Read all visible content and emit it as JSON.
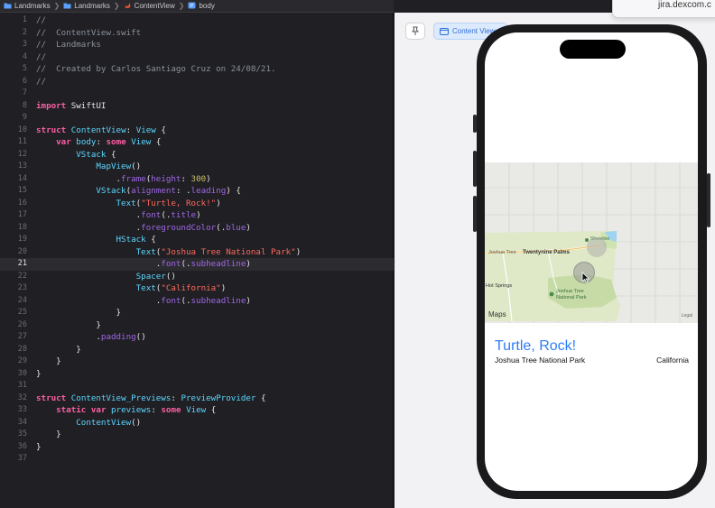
{
  "breadcrumb": {
    "items": [
      {
        "label": "Landmarks",
        "icon": "folder-icon"
      },
      {
        "label": "Landmarks",
        "icon": "folder-icon"
      },
      {
        "label": "ContentView",
        "icon": "swift-file-icon"
      },
      {
        "label": "body",
        "icon": "property-icon"
      }
    ]
  },
  "editor": {
    "current_line": 21,
    "lines": [
      [
        [
          "cm",
          "//"
        ]
      ],
      [
        [
          "cm",
          "//  ContentView.swift"
        ]
      ],
      [
        [
          "cm",
          "//  Landmarks"
        ]
      ],
      [
        [
          "cm",
          "//"
        ]
      ],
      [
        [
          "cm",
          "//  Created by Carlos Santiago Cruz on 24/08/21."
        ]
      ],
      [
        [
          "cm",
          "//"
        ]
      ],
      [],
      [
        [
          "kw",
          "import"
        ],
        [
          "pl",
          " SwiftUI"
        ]
      ],
      [],
      [
        [
          "kw",
          "struct"
        ],
        [
          "pl",
          " "
        ],
        [
          "ty",
          "ContentView"
        ],
        [
          "pl",
          ": "
        ],
        [
          "ty",
          "View"
        ],
        [
          "pl",
          " {"
        ]
      ],
      [
        [
          "pl",
          "    "
        ],
        [
          "kw",
          "var"
        ],
        [
          "pl",
          " "
        ],
        [
          "ty",
          "body"
        ],
        [
          "pl",
          ": "
        ],
        [
          "kw",
          "some"
        ],
        [
          "pl",
          " "
        ],
        [
          "ty",
          "View"
        ],
        [
          "pl",
          " {"
        ]
      ],
      [
        [
          "pl",
          "        "
        ],
        [
          "ty",
          "VStack"
        ],
        [
          "pl",
          " {"
        ]
      ],
      [
        [
          "pl",
          "            "
        ],
        [
          "ty",
          "MapView"
        ],
        [
          "pl",
          "()"
        ]
      ],
      [
        [
          "pl",
          "                ."
        ],
        [
          "fn",
          "frame"
        ],
        [
          "pl",
          "("
        ],
        [
          "fn",
          "height"
        ],
        [
          "pl",
          ": "
        ],
        [
          "nm",
          "300"
        ],
        [
          "pl",
          ")"
        ]
      ],
      [
        [
          "pl",
          "            "
        ],
        [
          "ty",
          "VStack"
        ],
        [
          "pl",
          "("
        ],
        [
          "fn",
          "alignment"
        ],
        [
          "pl",
          ": ."
        ],
        [
          "fn",
          "leading"
        ],
        [
          "pl",
          ") {"
        ]
      ],
      [
        [
          "pl",
          "                "
        ],
        [
          "ty",
          "Text"
        ],
        [
          "pl",
          "("
        ],
        [
          "st",
          "\"Turtle, Rock!\""
        ],
        [
          "pl",
          ")"
        ]
      ],
      [
        [
          "pl",
          "                    ."
        ],
        [
          "fn",
          "font"
        ],
        [
          "pl",
          "(."
        ],
        [
          "fn",
          "title"
        ],
        [
          "pl",
          ")"
        ]
      ],
      [
        [
          "pl",
          "                    ."
        ],
        [
          "fn",
          "foregroundColor"
        ],
        [
          "pl",
          "(."
        ],
        [
          "fn",
          "blue"
        ],
        [
          "pl",
          ")"
        ]
      ],
      [
        [
          "pl",
          "                "
        ],
        [
          "ty",
          "HStack"
        ],
        [
          "pl",
          " {"
        ]
      ],
      [
        [
          "pl",
          "                    "
        ],
        [
          "ty",
          "Text"
        ],
        [
          "pl",
          "("
        ],
        [
          "st",
          "\"Joshua Tree National Park\""
        ],
        [
          "pl",
          ")"
        ]
      ],
      [
        [
          "pl",
          "                        ."
        ],
        [
          "fn",
          "font"
        ],
        [
          "pl",
          "(."
        ],
        [
          "fn",
          "subheadline"
        ],
        [
          "pl",
          ")"
        ]
      ],
      [
        [
          "pl",
          "                    "
        ],
        [
          "ty",
          "Spacer"
        ],
        [
          "pl",
          "()"
        ]
      ],
      [
        [
          "pl",
          "                    "
        ],
        [
          "ty",
          "Text"
        ],
        [
          "pl",
          "("
        ],
        [
          "st",
          "\"California\""
        ],
        [
          "pl",
          ")"
        ]
      ],
      [
        [
          "pl",
          "                        ."
        ],
        [
          "fn",
          "font"
        ],
        [
          "pl",
          "(."
        ],
        [
          "fn",
          "subheadline"
        ],
        [
          "pl",
          ")"
        ]
      ],
      [
        [
          "pl",
          "                }"
        ]
      ],
      [
        [
          "pl",
          "            }"
        ]
      ],
      [
        [
          "pl",
          "            ."
        ],
        [
          "fn",
          "padding"
        ],
        [
          "pl",
          "()"
        ]
      ],
      [
        [
          "pl",
          "        }"
        ]
      ],
      [
        [
          "pl",
          "    }"
        ]
      ],
      [
        [
          "pl",
          "}"
        ]
      ],
      [],
      [
        [
          "kw",
          "struct"
        ],
        [
          "pl",
          " "
        ],
        [
          "ty",
          "ContentView_Previews"
        ],
        [
          "pl",
          ": "
        ],
        [
          "ty",
          "PreviewProvider"
        ],
        [
          "pl",
          " {"
        ]
      ],
      [
        [
          "pl",
          "    "
        ],
        [
          "kw",
          "static"
        ],
        [
          "pl",
          " "
        ],
        [
          "kw",
          "var"
        ],
        [
          "pl",
          " "
        ],
        [
          "ty",
          "previews"
        ],
        [
          "pl",
          ": "
        ],
        [
          "kw",
          "some"
        ],
        [
          "pl",
          " "
        ],
        [
          "ty",
          "View"
        ],
        [
          "pl",
          " {"
        ]
      ],
      [
        [
          "pl",
          "        "
        ],
        [
          "ty",
          "ContentView"
        ],
        [
          "pl",
          "()"
        ]
      ],
      [
        [
          "pl",
          "    }"
        ]
      ],
      [
        [
          "pl",
          "}"
        ]
      ],
      []
    ]
  },
  "preview": {
    "tab_label": "Content View",
    "pin_icon": "pin-icon",
    "tab_icon": "preview-window-icon"
  },
  "browser": {
    "url": "jira.dexcom.c"
  },
  "app": {
    "title": "Turtle, Rock!",
    "park": "Joshua Tree National Park",
    "state": "California",
    "title_color": "#2f7df6"
  },
  "map": {
    "labels": {
      "joshua_tree_city": "Joshua Tree",
      "twentynine_palms": "Twentynine Palms",
      "shoreline": "Shoreline",
      "hot_springs": "Hot Springs",
      "park_line1": "Joshua Tree",
      "park_line2": "National Park"
    },
    "maps_logo": "Maps",
    "legal": "Legal"
  },
  "colors": {
    "editor_bg": "#1f1f24",
    "keyword": "#fc5fa3",
    "type": "#5dd8ff",
    "function": "#a167e6",
    "string": "#fc6a5d",
    "number": "#d0bf69",
    "comment": "#8a9199"
  }
}
